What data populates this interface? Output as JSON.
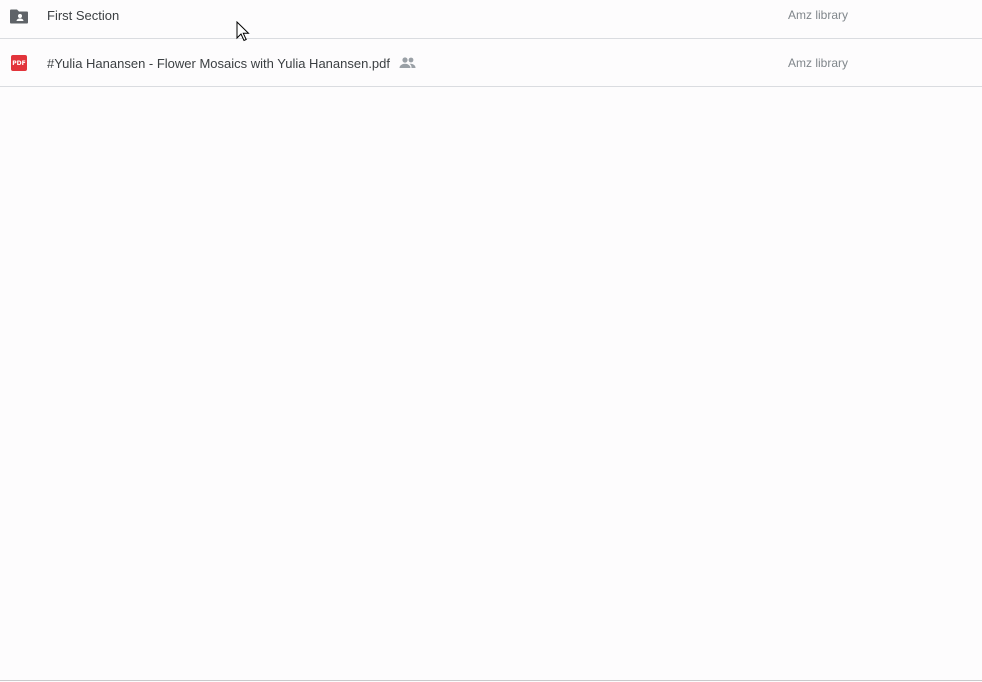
{
  "file_list": {
    "rows": [
      {
        "icon": "shared-folder-icon",
        "name": "First Section",
        "location": "Amz library"
      },
      {
        "icon": "pdf-icon",
        "icon_text": "PDF",
        "name": "#Yulia Hanansen - Flower Mosaics with Yulia Hanansen.pdf",
        "shared_icon": "people-icon",
        "location": "Amz library"
      }
    ]
  },
  "colors": {
    "background": "#fdfcfd",
    "divider": "#dadce0",
    "folder_icon": "#5f6368",
    "pdf_red": "#e2343b",
    "name_text": "#3c4043",
    "location_text": "#80868b"
  }
}
